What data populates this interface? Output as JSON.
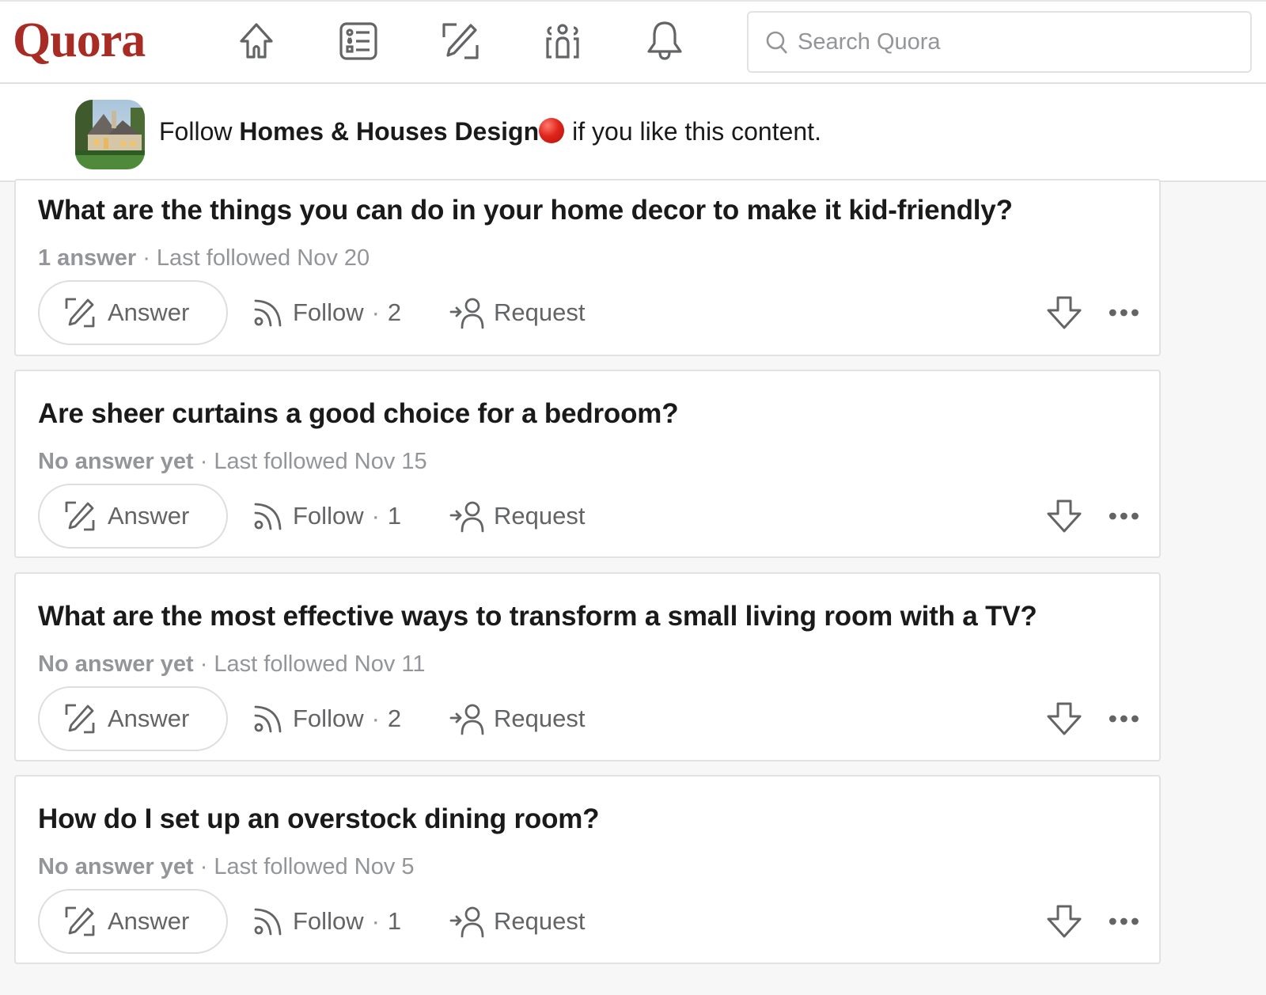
{
  "header": {
    "logo": "Quora",
    "nav": [
      {
        "name": "home-icon"
      },
      {
        "name": "following-icon"
      },
      {
        "name": "answer-icon"
      },
      {
        "name": "spaces-icon"
      },
      {
        "name": "notifications-icon"
      }
    ],
    "search": {
      "placeholder": "Search Quora",
      "value": "",
      "icon": "search-icon"
    }
  },
  "banner": {
    "prefix": "Follow ",
    "space_name": "Homes & Houses Design",
    "suffix": "if you like this content.",
    "badge_color": "#e0251b"
  },
  "actions": {
    "answer_label": "Answer",
    "follow_label": "Follow",
    "request_label": "Request",
    "separator": "·"
  },
  "questions": [
    {
      "title": "What are the things you can do in your home decor to make it kid-friendly?",
      "answers": "1 answer",
      "last_followed": "· Last followed Nov 20",
      "follow_count": "2"
    },
    {
      "title": "Are sheer curtains a good choice for a bedroom?",
      "answers": "No answer yet",
      "last_followed": "· Last followed Nov 15",
      "follow_count": "1"
    },
    {
      "title": "What are the most effective ways to transform a small living room with a TV?",
      "answers": "No answer yet",
      "last_followed": "· Last followed Nov 11",
      "follow_count": "2"
    },
    {
      "title": "How do I set up an overstock dining room?",
      "answers": "No answer yet",
      "last_followed": "· Last followed Nov 5",
      "follow_count": "1"
    }
  ],
  "colors": {
    "brand": "#a82b24",
    "icon": "#636466",
    "meta": "#939598"
  }
}
